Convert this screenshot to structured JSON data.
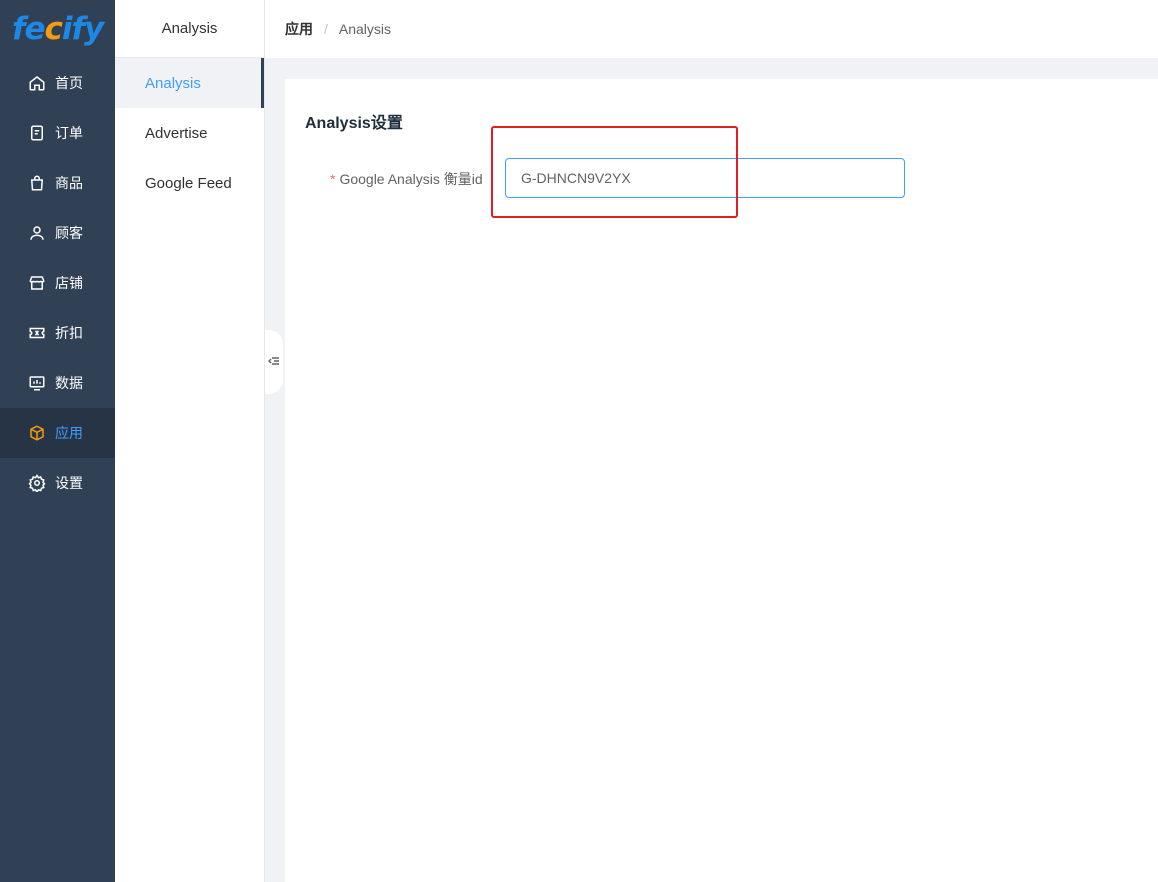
{
  "logo": {
    "text_a": "fe",
    "text_b": "c",
    "text_c": "ify"
  },
  "sidebar": {
    "items": [
      {
        "label": "首页",
        "icon": "home-icon"
      },
      {
        "label": "订单",
        "icon": "order-icon"
      },
      {
        "label": "商品",
        "icon": "bag-icon"
      },
      {
        "label": "顾客",
        "icon": "user-icon"
      },
      {
        "label": "店铺",
        "icon": "store-icon"
      },
      {
        "label": "折扣",
        "icon": "ticket-icon"
      },
      {
        "label": "数据",
        "icon": "chart-icon"
      },
      {
        "label": "应用",
        "icon": "box-icon",
        "active": true
      },
      {
        "label": "设置",
        "icon": "gear-icon"
      }
    ]
  },
  "submenu": {
    "title": "Analysis",
    "items": [
      {
        "label": "Analysis",
        "active": true
      },
      {
        "label": "Advertise"
      },
      {
        "label": "Google Feed"
      }
    ]
  },
  "breadcrumb": {
    "parent": "应用",
    "separator": "/",
    "current": "Analysis"
  },
  "panel": {
    "title": "Analysis设置",
    "field": {
      "required_mark": "*",
      "label": "Google Analysis 衡量id",
      "value": "G-DHNCN9V2YX"
    }
  },
  "colors": {
    "sidebar_bg": "#304156",
    "accent": "#409eff",
    "highlight": "#e02020"
  }
}
